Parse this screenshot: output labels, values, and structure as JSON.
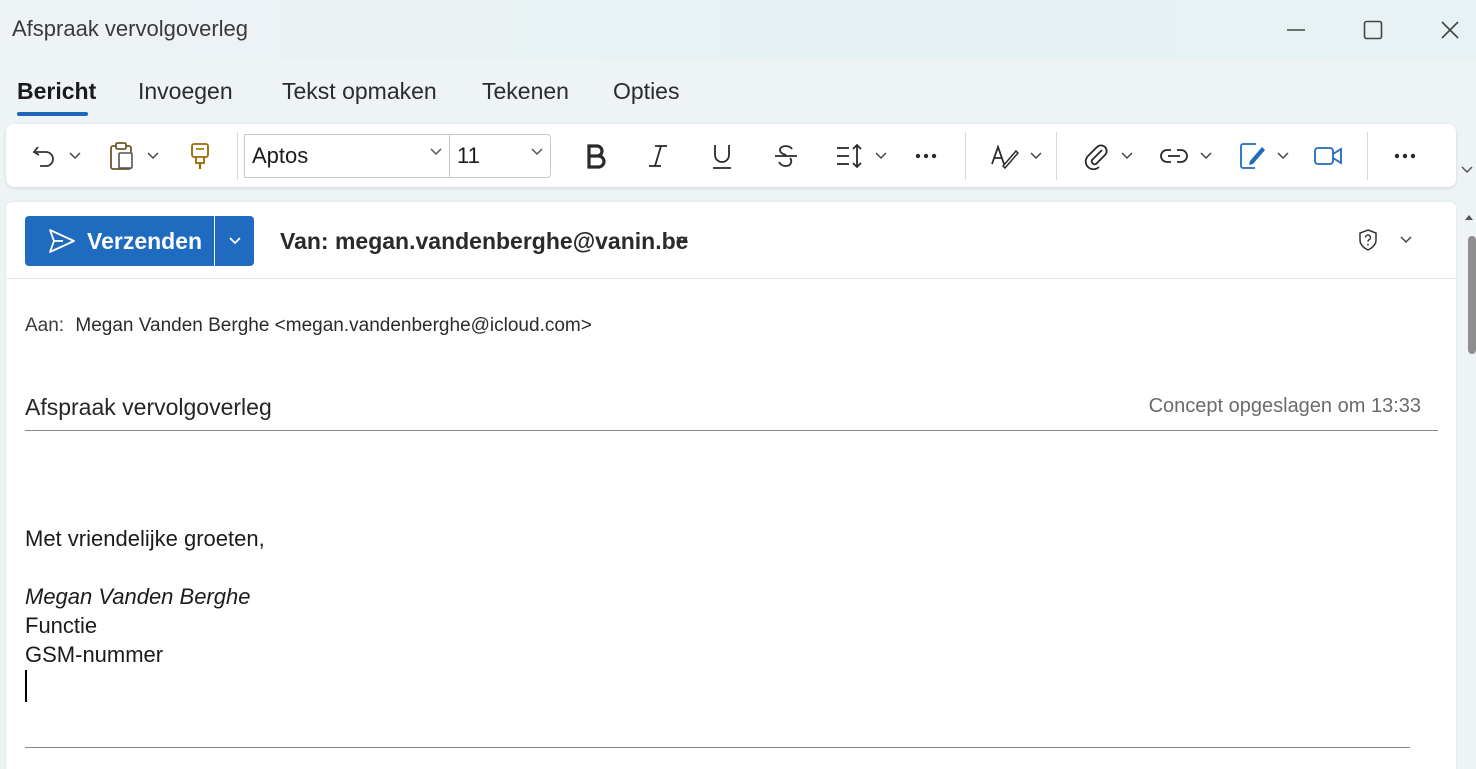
{
  "window": {
    "title": "Afspraak vervolgoverleg",
    "controls": {
      "minimize_icon": "minimize-icon",
      "maximize_icon": "maximize-icon",
      "close_icon": "close-icon"
    }
  },
  "tabs": [
    {
      "label": "Bericht",
      "active": true
    },
    {
      "label": "Invoegen"
    },
    {
      "label": "Tekst opmaken"
    },
    {
      "label": "Tekenen"
    },
    {
      "label": "Opties"
    }
  ],
  "ribbon": {
    "font_name": "Aptos",
    "font_size": "11",
    "icons": [
      "undo-icon",
      "paste-icon",
      "format-painter-icon",
      "bold-icon",
      "italic-icon",
      "underline-icon",
      "strikethrough-icon",
      "paragraph-spacing-icon",
      "more-icon",
      "editor-icon",
      "attach-icon",
      "link-icon",
      "signature-icon",
      "teams-meeting-icon",
      "more-icon"
    ]
  },
  "compose": {
    "send_label": "Verzenden",
    "from": "Van: megan.vandenberghe@vanin.be",
    "to_label": "Aan:",
    "to_value": "Megan Vanden Berghe <megan.vandenberghe@icloud.com>",
    "subject": "Afspraak vervolgoverleg",
    "saved_status": "Concept opgeslagen om 13:33",
    "body": {
      "closing": "Met vriendelijke groeten,",
      "name": "Megan Vanden Berghe",
      "function": "Functie",
      "phone": "GSM-nummer"
    }
  },
  "colors": {
    "accent": "#1f6bbf",
    "tab_underline": "#1f67b9",
    "titlebar_bg": "#e6f1f4"
  }
}
